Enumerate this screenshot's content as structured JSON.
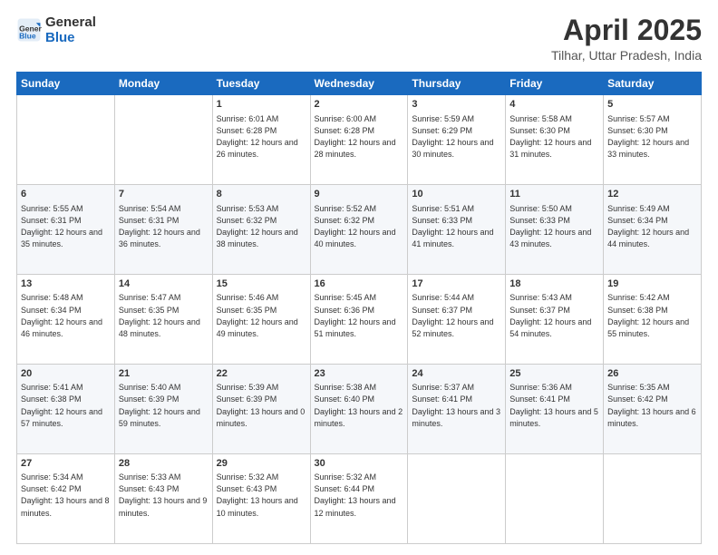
{
  "logo": {
    "general": "General",
    "blue": "Blue"
  },
  "header": {
    "month": "April 2025",
    "location": "Tilhar, Uttar Pradesh, India"
  },
  "weekdays": [
    "Sunday",
    "Monday",
    "Tuesday",
    "Wednesday",
    "Thursday",
    "Friday",
    "Saturday"
  ],
  "weeks": [
    [
      {
        "day": "",
        "sunrise": "",
        "sunset": "",
        "daylight": ""
      },
      {
        "day": "",
        "sunrise": "",
        "sunset": "",
        "daylight": ""
      },
      {
        "day": "1",
        "sunrise": "Sunrise: 6:01 AM",
        "sunset": "Sunset: 6:28 PM",
        "daylight": "Daylight: 12 hours and 26 minutes."
      },
      {
        "day": "2",
        "sunrise": "Sunrise: 6:00 AM",
        "sunset": "Sunset: 6:28 PM",
        "daylight": "Daylight: 12 hours and 28 minutes."
      },
      {
        "day": "3",
        "sunrise": "Sunrise: 5:59 AM",
        "sunset": "Sunset: 6:29 PM",
        "daylight": "Daylight: 12 hours and 30 minutes."
      },
      {
        "day": "4",
        "sunrise": "Sunrise: 5:58 AM",
        "sunset": "Sunset: 6:30 PM",
        "daylight": "Daylight: 12 hours and 31 minutes."
      },
      {
        "day": "5",
        "sunrise": "Sunrise: 5:57 AM",
        "sunset": "Sunset: 6:30 PM",
        "daylight": "Daylight: 12 hours and 33 minutes."
      }
    ],
    [
      {
        "day": "6",
        "sunrise": "Sunrise: 5:55 AM",
        "sunset": "Sunset: 6:31 PM",
        "daylight": "Daylight: 12 hours and 35 minutes."
      },
      {
        "day": "7",
        "sunrise": "Sunrise: 5:54 AM",
        "sunset": "Sunset: 6:31 PM",
        "daylight": "Daylight: 12 hours and 36 minutes."
      },
      {
        "day": "8",
        "sunrise": "Sunrise: 5:53 AM",
        "sunset": "Sunset: 6:32 PM",
        "daylight": "Daylight: 12 hours and 38 minutes."
      },
      {
        "day": "9",
        "sunrise": "Sunrise: 5:52 AM",
        "sunset": "Sunset: 6:32 PM",
        "daylight": "Daylight: 12 hours and 40 minutes."
      },
      {
        "day": "10",
        "sunrise": "Sunrise: 5:51 AM",
        "sunset": "Sunset: 6:33 PM",
        "daylight": "Daylight: 12 hours and 41 minutes."
      },
      {
        "day": "11",
        "sunrise": "Sunrise: 5:50 AM",
        "sunset": "Sunset: 6:33 PM",
        "daylight": "Daylight: 12 hours and 43 minutes."
      },
      {
        "day": "12",
        "sunrise": "Sunrise: 5:49 AM",
        "sunset": "Sunset: 6:34 PM",
        "daylight": "Daylight: 12 hours and 44 minutes."
      }
    ],
    [
      {
        "day": "13",
        "sunrise": "Sunrise: 5:48 AM",
        "sunset": "Sunset: 6:34 PM",
        "daylight": "Daylight: 12 hours and 46 minutes."
      },
      {
        "day": "14",
        "sunrise": "Sunrise: 5:47 AM",
        "sunset": "Sunset: 6:35 PM",
        "daylight": "Daylight: 12 hours and 48 minutes."
      },
      {
        "day": "15",
        "sunrise": "Sunrise: 5:46 AM",
        "sunset": "Sunset: 6:35 PM",
        "daylight": "Daylight: 12 hours and 49 minutes."
      },
      {
        "day": "16",
        "sunrise": "Sunrise: 5:45 AM",
        "sunset": "Sunset: 6:36 PM",
        "daylight": "Daylight: 12 hours and 51 minutes."
      },
      {
        "day": "17",
        "sunrise": "Sunrise: 5:44 AM",
        "sunset": "Sunset: 6:37 PM",
        "daylight": "Daylight: 12 hours and 52 minutes."
      },
      {
        "day": "18",
        "sunrise": "Sunrise: 5:43 AM",
        "sunset": "Sunset: 6:37 PM",
        "daylight": "Daylight: 12 hours and 54 minutes."
      },
      {
        "day": "19",
        "sunrise": "Sunrise: 5:42 AM",
        "sunset": "Sunset: 6:38 PM",
        "daylight": "Daylight: 12 hours and 55 minutes."
      }
    ],
    [
      {
        "day": "20",
        "sunrise": "Sunrise: 5:41 AM",
        "sunset": "Sunset: 6:38 PM",
        "daylight": "Daylight: 12 hours and 57 minutes."
      },
      {
        "day": "21",
        "sunrise": "Sunrise: 5:40 AM",
        "sunset": "Sunset: 6:39 PM",
        "daylight": "Daylight: 12 hours and 59 minutes."
      },
      {
        "day": "22",
        "sunrise": "Sunrise: 5:39 AM",
        "sunset": "Sunset: 6:39 PM",
        "daylight": "Daylight: 13 hours and 0 minutes."
      },
      {
        "day": "23",
        "sunrise": "Sunrise: 5:38 AM",
        "sunset": "Sunset: 6:40 PM",
        "daylight": "Daylight: 13 hours and 2 minutes."
      },
      {
        "day": "24",
        "sunrise": "Sunrise: 5:37 AM",
        "sunset": "Sunset: 6:41 PM",
        "daylight": "Daylight: 13 hours and 3 minutes."
      },
      {
        "day": "25",
        "sunrise": "Sunrise: 5:36 AM",
        "sunset": "Sunset: 6:41 PM",
        "daylight": "Daylight: 13 hours and 5 minutes."
      },
      {
        "day": "26",
        "sunrise": "Sunrise: 5:35 AM",
        "sunset": "Sunset: 6:42 PM",
        "daylight": "Daylight: 13 hours and 6 minutes."
      }
    ],
    [
      {
        "day": "27",
        "sunrise": "Sunrise: 5:34 AM",
        "sunset": "Sunset: 6:42 PM",
        "daylight": "Daylight: 13 hours and 8 minutes."
      },
      {
        "day": "28",
        "sunrise": "Sunrise: 5:33 AM",
        "sunset": "Sunset: 6:43 PM",
        "daylight": "Daylight: 13 hours and 9 minutes."
      },
      {
        "day": "29",
        "sunrise": "Sunrise: 5:32 AM",
        "sunset": "Sunset: 6:43 PM",
        "daylight": "Daylight: 13 hours and 10 minutes."
      },
      {
        "day": "30",
        "sunrise": "Sunrise: 5:32 AM",
        "sunset": "Sunset: 6:44 PM",
        "daylight": "Daylight: 13 hours and 12 minutes."
      },
      {
        "day": "",
        "sunrise": "",
        "sunset": "",
        "daylight": ""
      },
      {
        "day": "",
        "sunrise": "",
        "sunset": "",
        "daylight": ""
      },
      {
        "day": "",
        "sunrise": "",
        "sunset": "",
        "daylight": ""
      }
    ]
  ]
}
